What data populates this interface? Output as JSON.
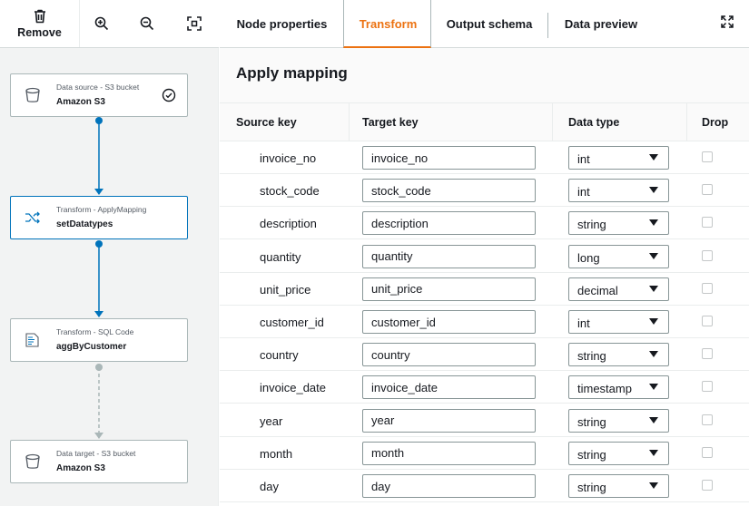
{
  "toolbar": {
    "remove_label": "Remove",
    "icons": [
      "trash-icon",
      "zoom-in-icon",
      "zoom-out-icon",
      "fit-to-screen-icon"
    ]
  },
  "nodes": [
    {
      "type": "Data source - S3 bucket",
      "name": "Amazon S3",
      "icon": "bucket-icon",
      "verified": true
    },
    {
      "type": "Transform - ApplyMapping",
      "name": "setDatatypes",
      "icon": "shuffle-icon",
      "selected": true
    },
    {
      "type": "Transform - SQL Code",
      "name": "aggByCustomer",
      "icon": "sql-code-icon"
    },
    {
      "type": "Data target - S3 bucket",
      "name": "Amazon S3",
      "icon": "bucket-icon"
    }
  ],
  "tabs": [
    {
      "label": "Node properties",
      "active": false
    },
    {
      "label": "Transform",
      "active": true
    },
    {
      "label": "Output schema",
      "active": false
    },
    {
      "label": "Data preview",
      "active": false
    }
  ],
  "panel": {
    "title": "Apply mapping",
    "columns": {
      "source": "Source key",
      "target": "Target key",
      "type": "Data type",
      "drop": "Drop"
    },
    "rows": [
      {
        "source": "invoice_no",
        "target": "invoice_no",
        "type": "int"
      },
      {
        "source": "stock_code",
        "target": "stock_code",
        "type": "int"
      },
      {
        "source": "description",
        "target": "description",
        "type": "string"
      },
      {
        "source": "quantity",
        "target": "quantity",
        "type": "long"
      },
      {
        "source": "unit_price",
        "target": "unit_price",
        "type": "decimal"
      },
      {
        "source": "customer_id",
        "target": "customer_id",
        "type": "int"
      },
      {
        "source": "country",
        "target": "country",
        "type": "string"
      },
      {
        "source": "invoice_date",
        "target": "invoice_date",
        "type": "timestamp"
      },
      {
        "source": "year",
        "target": "year",
        "type": "string"
      },
      {
        "source": "month",
        "target": "month",
        "type": "string"
      },
      {
        "source": "day",
        "target": "day",
        "type": "string"
      }
    ]
  },
  "colors": {
    "accent": "#ec7211",
    "link": "#0073bb",
    "border": "#aab7b8"
  }
}
